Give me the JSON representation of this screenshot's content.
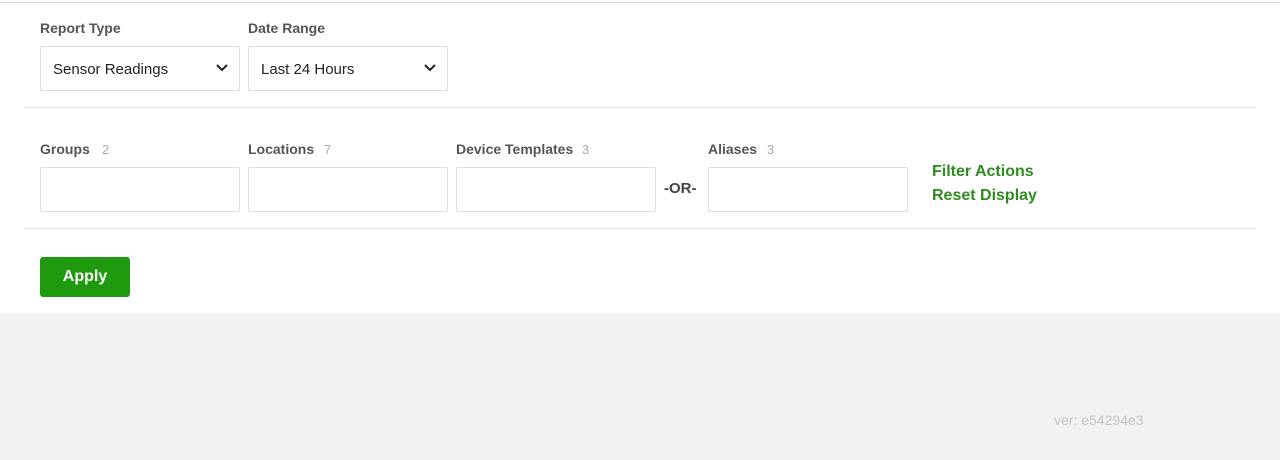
{
  "report": {
    "report_type": {
      "label": "Report Type",
      "value": "Sensor Readings"
    },
    "date_range": {
      "label": "Date Range",
      "value": "Last 24 Hours"
    }
  },
  "filters": {
    "groups": {
      "label": "Groups",
      "count": "2",
      "value": ""
    },
    "locations": {
      "label": "Locations",
      "count": "7",
      "value": ""
    },
    "device_templates": {
      "label": "Device Templates",
      "count": "3",
      "value": ""
    },
    "or_text": "-OR-",
    "aliases": {
      "label": "Aliases",
      "count": "3",
      "value": ""
    },
    "filter_actions": "Filter Actions",
    "reset_display": "Reset Display"
  },
  "apply_label": "Apply",
  "version": "ver: e54294e3",
  "colors": {
    "accent": "#1f9a0f",
    "link": "#2e8b1e",
    "footer_bg": "#f2f2f2"
  },
  "icons": {
    "select_arrow": "chevron-down-icon"
  }
}
